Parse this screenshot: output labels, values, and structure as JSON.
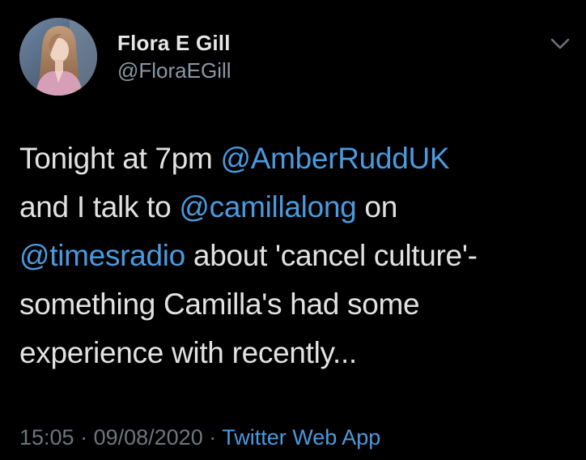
{
  "author": {
    "display_name": "Flora E Gill",
    "handle": "@FloraEGill",
    "avatar_icon": "profile-photo"
  },
  "tweet": {
    "lines": [
      [
        {
          "text": "Tonight at 7pm ",
          "mention": false
        },
        {
          "text": "@AmberRuddUK",
          "mention": true
        }
      ],
      [
        {
          "text": "and I talk to ",
          "mention": false
        },
        {
          "text": "@camillalong",
          "mention": true
        },
        {
          "text": " on",
          "mention": false
        }
      ],
      [
        {
          "text": "@timesradio",
          "mention": true
        },
        {
          "text": " about 'cancel culture'-",
          "mention": false
        }
      ],
      [
        {
          "text": "something Camilla's had some",
          "mention": false
        }
      ],
      [
        {
          "text": "experience with recently...",
          "mention": false
        }
      ]
    ]
  },
  "meta": {
    "time": "15:05",
    "separator": " · ",
    "date": "09/08/2020",
    "source": "Twitter Web App"
  },
  "colors": {
    "background": "#000000",
    "text": "#e2e2e2",
    "muted": "#6e767d",
    "link": "#4a9ae0"
  },
  "icons": {
    "menu": "chevron-down-icon"
  }
}
